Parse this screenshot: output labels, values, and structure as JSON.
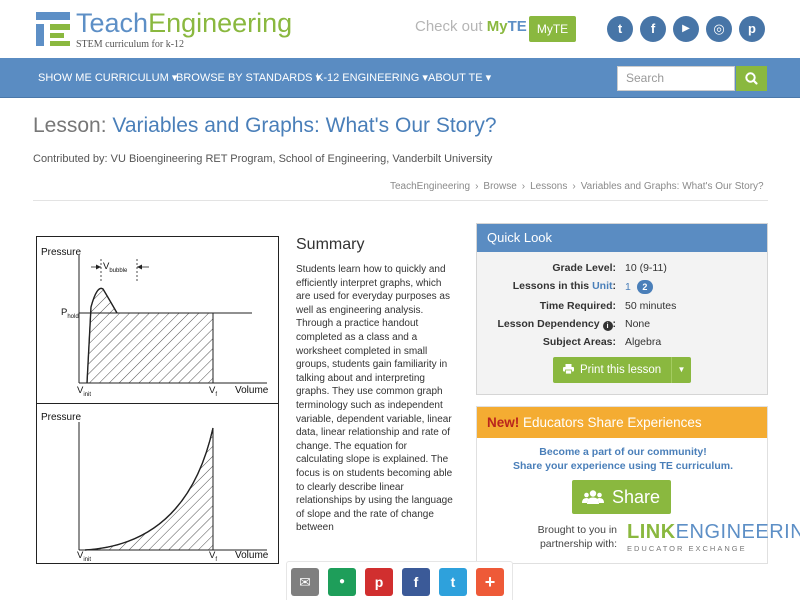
{
  "brand": {
    "name_part1": "Teach",
    "name_part2": "Engineering",
    "tagline": "STEM curriculum for k-12"
  },
  "header": {
    "checkout_prefix": "Check out ",
    "checkout_my": "My",
    "checkout_te": "TE",
    "myte_button": "MyTE",
    "social_icons": [
      "twitter-icon",
      "facebook-icon",
      "youtube-icon",
      "instagram-icon",
      "pinterest-icon"
    ],
    "social_glyphs": [
      "t",
      "f",
      "▶",
      "◎",
      "p"
    ]
  },
  "nav": {
    "items": [
      "SHOW ME CURRICULUM ▾",
      "BROWSE BY STANDARDS ▾",
      "K-12 ENGINEERING ▾",
      "ABOUT TE ▾"
    ],
    "search_placeholder": "Search",
    "search_icon": "search-icon"
  },
  "lesson": {
    "prefix": "Lesson: ",
    "title": "Variables and Graphs: What's Our Story?",
    "contributed_by": "Contributed by: VU Bioengineering RET Program, School of Engineering, Vanderbilt University"
  },
  "breadcrumb": [
    "TeachEngineering",
    "Browse",
    "Lessons",
    "Variables and Graphs: What's Our Story?"
  ],
  "graphs": {
    "top": {
      "y_label": "Pressure",
      "x_label": "Volume",
      "bubble_label": "V",
      "bubble_sub": "bubble",
      "hold_label": "P",
      "hold_sub": "hold",
      "vinit_label": "V",
      "vinit_sub": "init",
      "vf_label": "V",
      "vf_sub": "f"
    },
    "bottom": {
      "y_label": "Pressure",
      "x_label": "Volume",
      "vinit_label": "V",
      "vinit_sub": "init",
      "vf_label": "V",
      "vf_sub": "f"
    }
  },
  "summary": {
    "heading": "Summary",
    "text": "Students learn how to quickly and efficiently interpret graphs, which are used for everyday purposes as well as engineering analysis. Through a practice handout completed as a class and a worksheet completed in small groups, students gain familiarity in talking about and interpreting graphs. They use common graph terminology such as independent variable, dependent variable, linear data, linear relationship and rate of change. The equation for calculating slope is explained. The focus is on students becoming able to clearly describe linear relationships by using the language of slope and the rate of change between"
  },
  "quick_look": {
    "heading": "Quick Look",
    "grade_level_label": "Grade Level:",
    "grade_level_value": "10 (9-11)",
    "lessons_label_prefix": "Lessons in this ",
    "lessons_label_link": "Unit",
    "lessons_label_suffix": ":",
    "lessons_current": "1",
    "lessons_next": "2",
    "time_label": "Time Required:",
    "time_value": "50 minutes",
    "dependency_label": "Lesson Dependency",
    "dependency_info_icon": "info-icon",
    "dependency_value": "None",
    "subject_label": "Subject Areas:",
    "subject_value": "Algebra",
    "print_button": "Print this lesson",
    "print_icon": "printer-icon"
  },
  "educators": {
    "new_label": "New!",
    "heading": " Educators Share Experiences",
    "line1": "Become a part of our community!",
    "line2": "Share your experience using TE curriculum.",
    "share_button": "Share",
    "share_icon": "users-icon",
    "brought_line1": "Brought to you in",
    "brought_line2": "partnership with:",
    "partner_l": "LINK",
    "partner_rest": "ENGINEERING",
    "partner_sub": "EDUCATOR EXCHANGE"
  },
  "floating_share": {
    "icons": [
      "email-icon",
      "google-classroom-icon",
      "pinterest-icon",
      "facebook-icon",
      "twitter-icon",
      "more-plus-icon"
    ],
    "glyphs": [
      "✉",
      "●",
      "p",
      "f",
      "t",
      "+"
    ],
    "colors": [
      "#7f7f7f",
      "#1e9e5a",
      "#d12f2f",
      "#3b5a98",
      "#2ea1dc",
      "#ee5a38"
    ]
  },
  "colors": {
    "brand_blue": "#5a8cc2",
    "brand_green": "#8ab83f",
    "accent_orange": "#f4ac32"
  }
}
